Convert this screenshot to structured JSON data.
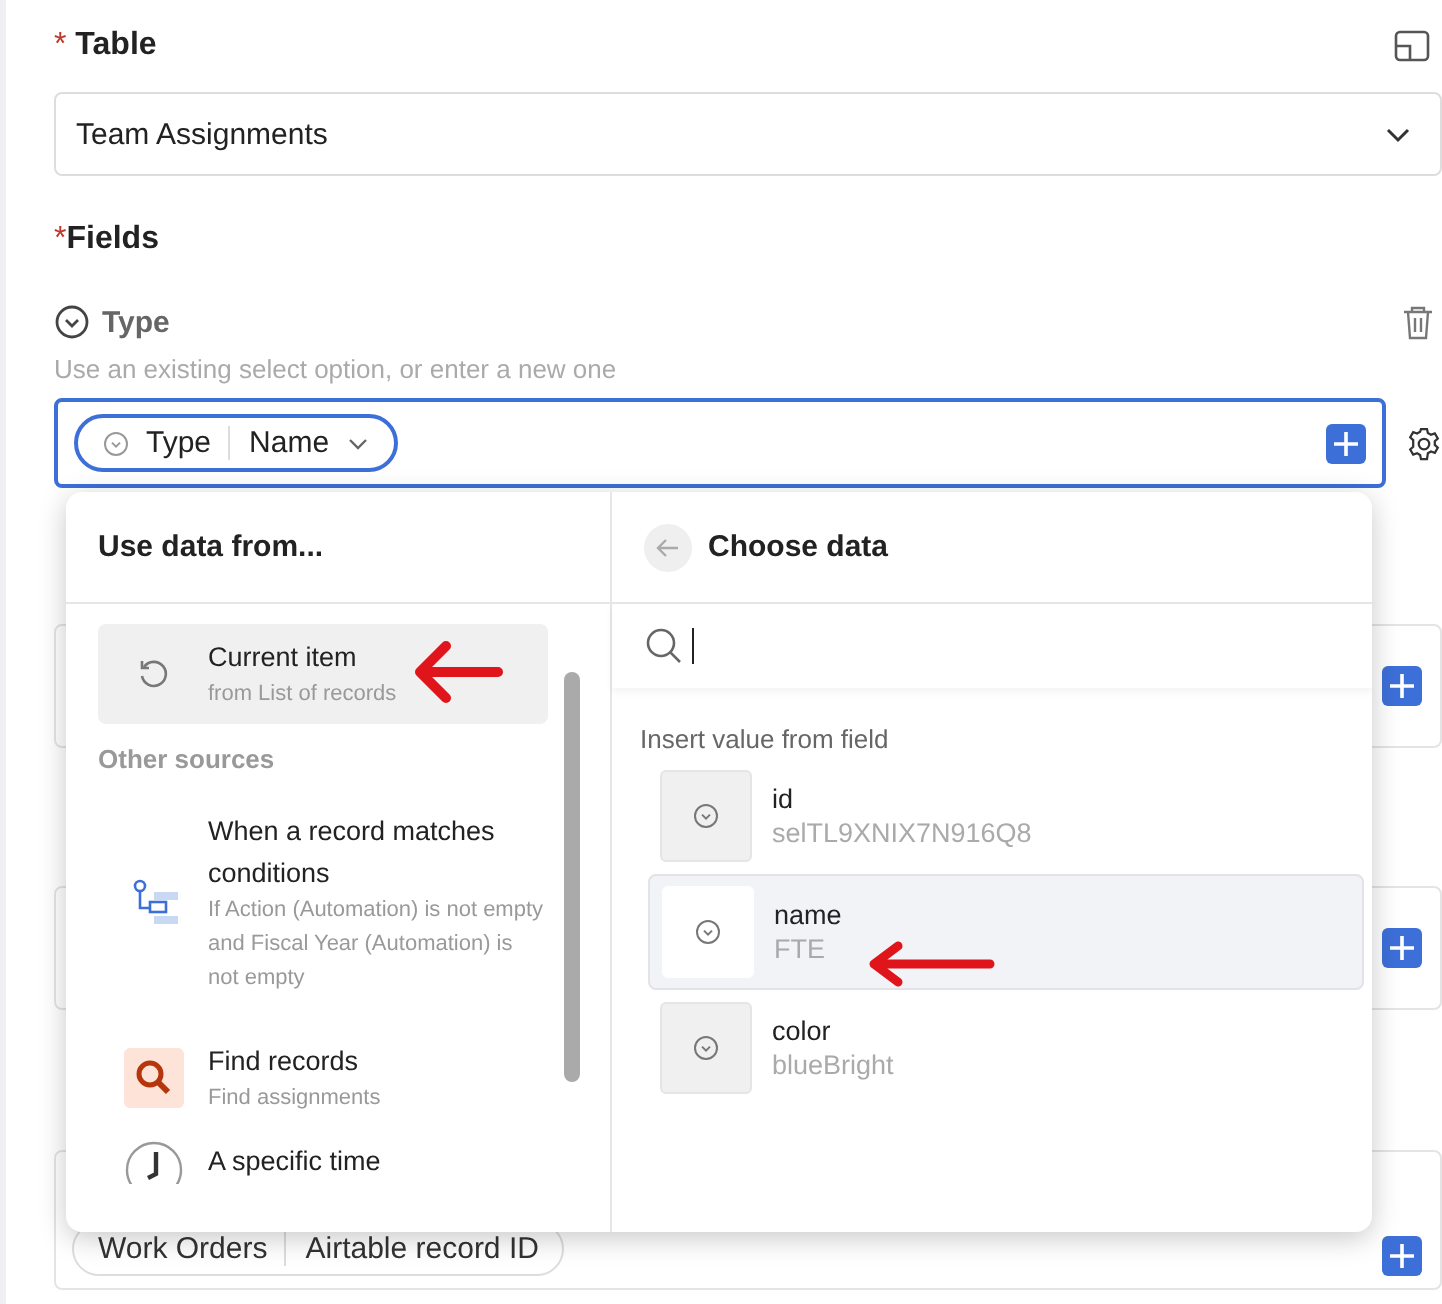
{
  "table": {
    "label": "Table",
    "required_mark": "*",
    "value": "Team Assignments"
  },
  "fields": {
    "label": "Fields",
    "required_mark": "*",
    "field": {
      "name": "Type",
      "hint": "Use an existing select option, or enter a new one",
      "token": {
        "label": "Type",
        "value": "Name"
      }
    },
    "bottom_token": {
      "label": "Work Orders",
      "value": "Airtable record ID"
    }
  },
  "popup": {
    "left": {
      "title": "Use data from...",
      "current": {
        "title": "Current item",
        "subtitle": "from List of records",
        "selected": true,
        "kind": "current"
      },
      "section": "Other sources",
      "sources": [
        {
          "kind": "condition",
          "title": "When a record matches conditions",
          "subtitle": "If Action (Automation) is not empty and Fiscal Year (Automation) is not empty",
          "selected": false
        },
        {
          "kind": "find",
          "title": "Find records",
          "subtitle": "Find assignments",
          "selected": false
        },
        {
          "kind": "time",
          "title": "A specific time",
          "selected": false
        }
      ]
    },
    "right": {
      "title": "Choose data",
      "section": "Insert value from field",
      "items": [
        {
          "name": "id",
          "value": "selTL9XNIX7N916Q8",
          "selected": false
        },
        {
          "name": "name",
          "value": "FTE",
          "selected": true
        },
        {
          "name": "color",
          "value": "blueBright",
          "selected": false
        }
      ]
    }
  }
}
